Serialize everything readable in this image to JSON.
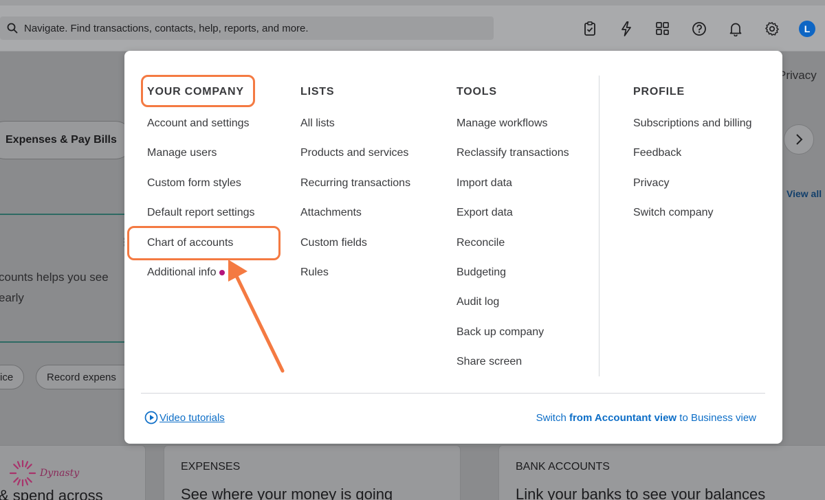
{
  "topbar": {
    "search_placeholder": "Navigate. Find transactions, contacts, help, reports, and more.",
    "icons": [
      "clipboard-check-icon",
      "lightning-icon",
      "apps-icon",
      "help-icon",
      "bell-icon",
      "gear-icon"
    ],
    "avatar_initial": "L"
  },
  "background": {
    "privacy": "Privacy",
    "pill_label": "Expenses & Pay Bills",
    "view_all": "View all",
    "dots": "⋮",
    "text_line1": "counts helps you see",
    "text_line2": "early",
    "chip1": "ice",
    "chip2": "Record expens",
    "logo_text": "Dynasty",
    "bottom_text": "& spend across",
    "cards": [
      {
        "title": "EXPENSES",
        "body": "See where your money is going"
      },
      {
        "title": "BANK ACCOUNTS",
        "body": "Link your banks to see your balances"
      }
    ]
  },
  "menu": {
    "columns": [
      {
        "heading": "YOUR COMPANY",
        "items": [
          "Account and settings",
          "Manage users",
          "Custom form styles",
          "Default report settings",
          "Chart of accounts",
          "Additional info"
        ]
      },
      {
        "heading": "LISTS",
        "items": [
          "All lists",
          "Products and services",
          "Recurring transactions",
          "Attachments",
          "Custom fields",
          "Rules"
        ]
      },
      {
        "heading": "TOOLS",
        "items": [
          "Manage workflows",
          "Reclassify transactions",
          "Import data",
          "Export data",
          "Reconcile",
          "Budgeting",
          "Audit log",
          "Back up company",
          "Share screen"
        ]
      },
      {
        "heading": "PROFILE",
        "items": [
          "Subscriptions and billing",
          "Feedback",
          "Privacy",
          "Switch company"
        ]
      }
    ],
    "footer": {
      "video_tutorials": "Video tutorials",
      "switch_prefix": "Switch ",
      "switch_from": "from Accountant view",
      "switch_suffix": " to Business view"
    }
  },
  "colors": {
    "highlight": "#f47a42",
    "link": "#0d6ec7",
    "notification_dot": "#b4147b"
  }
}
